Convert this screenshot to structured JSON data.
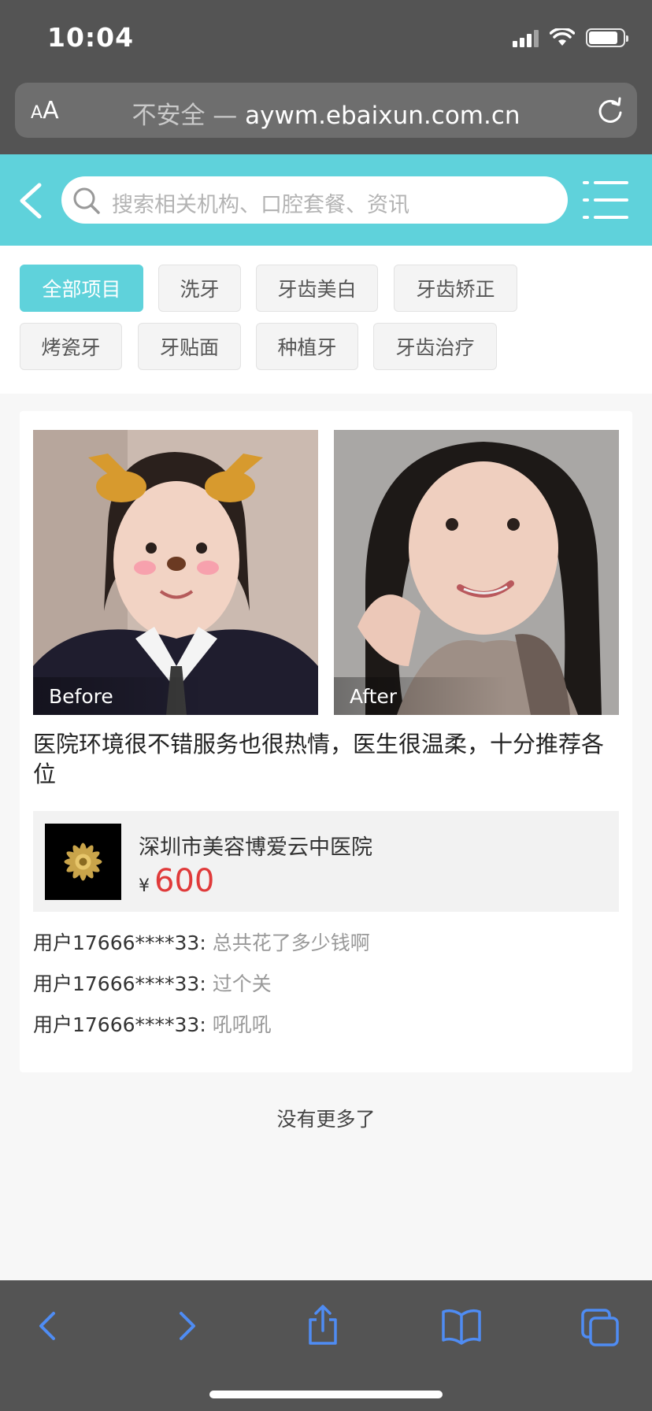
{
  "status": {
    "time": "10:04"
  },
  "browser": {
    "aa_label_small": "A",
    "aa_label": "A",
    "insecure_label": "不安全 —",
    "domain": "aywm.ebaixun.com.cn"
  },
  "header": {
    "search_placeholder": "搜索相关机构、口腔套餐、资讯"
  },
  "categories": [
    {
      "label": "全部项目",
      "active": true
    },
    {
      "label": "洗牙"
    },
    {
      "label": "牙齿美白"
    },
    {
      "label": "牙齿矫正"
    },
    {
      "label": "烤瓷牙"
    },
    {
      "label": "牙贴面"
    },
    {
      "label": "种植牙"
    },
    {
      "label": "牙齿治疗"
    }
  ],
  "case": {
    "before_label": "Before",
    "after_label": "After",
    "review": "医院环境很不错服务也很热情，医生很温柔，十分推荐各位",
    "clinic_name": "深圳市美容博爱云中医院",
    "price_symbol": "¥",
    "price": "600",
    "comments": [
      {
        "user": "用户17666****33:",
        "text": "总共花了多少钱啊"
      },
      {
        "user": "用户17666****33:",
        "text": "过个关"
      },
      {
        "user": "用户17666****33:",
        "text": "吼吼吼"
      }
    ]
  },
  "footer": {
    "no_more": "没有更多了"
  },
  "colors": {
    "accent": "#5fd2db",
    "price": "#e03a3a",
    "chrome": "#545454"
  },
  "icons": [
    "back-icon",
    "search-icon",
    "menu-icon",
    "reload-icon",
    "wifi-icon",
    "battery-icon",
    "share-icon",
    "bookmarks-icon",
    "tabs-icon"
  ]
}
